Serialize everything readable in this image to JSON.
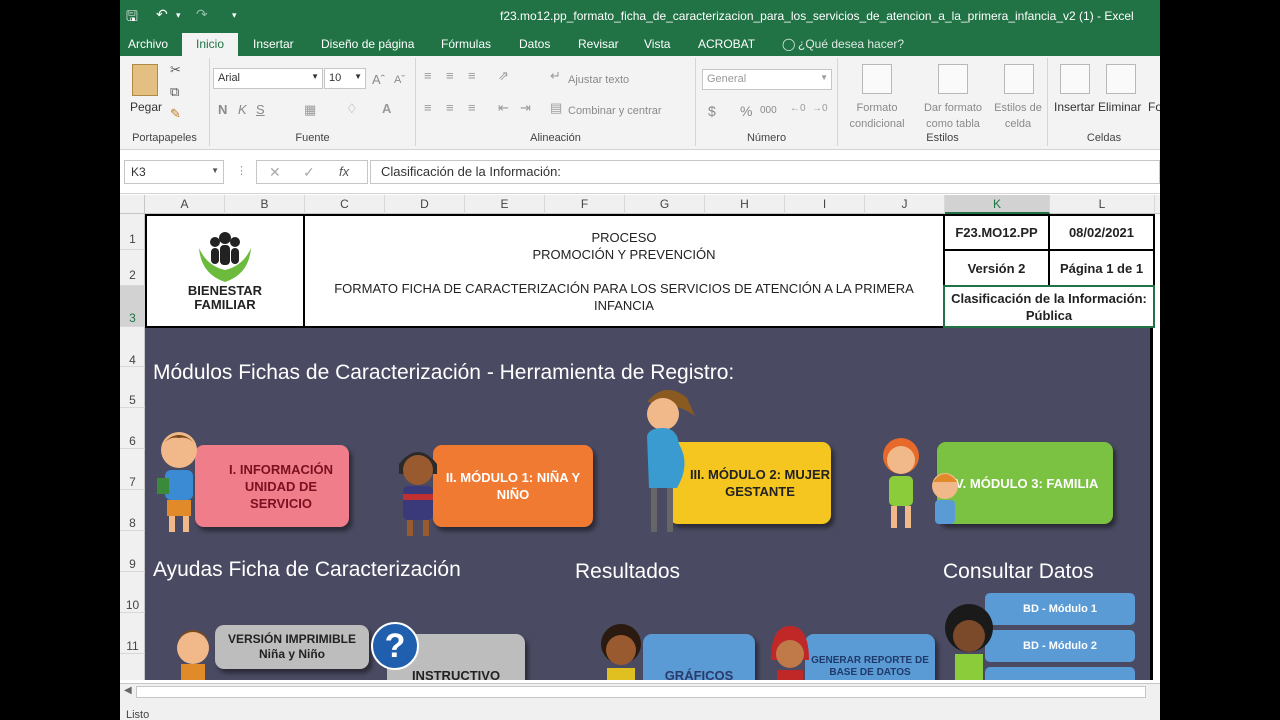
{
  "window": {
    "title": "f23.mo12.pp_formato_ficha_de_caracterizacion_para_los_servicios_de_atencion_a_la_primera_infancia_v2 (1) - Excel"
  },
  "tabs": [
    "Archivo",
    "Inicio",
    "Insertar",
    "Diseño de página",
    "Fórmulas",
    "Datos",
    "Revisar",
    "Vista",
    "ACROBAT",
    "¿Qué desea hacer?"
  ],
  "ribbon": {
    "portapapeles": {
      "label": "Portapapeles",
      "paste": "Pegar"
    },
    "fuente": {
      "label": "Fuente",
      "font": "Arial",
      "size": "10",
      "bold": "N",
      "italic": "K",
      "underline": "S"
    },
    "alineacion": {
      "label": "Alineación",
      "wrap": "Ajustar texto",
      "merge": "Combinar y centrar"
    },
    "numero": {
      "label": "Número",
      "format": "General",
      "currency": "$",
      "percent": "%",
      "thousands": "000"
    },
    "estilos": {
      "label": "Estilos",
      "cond": "Formato condicional",
      "table": "Dar formato como tabla",
      "cell": "Estilos de celda"
    },
    "celdas": {
      "label": "Celdas",
      "insert": "Insertar",
      "delete": "Eliminar",
      "format": "Fo"
    }
  },
  "formula_bar": {
    "name_box": "K3",
    "fx": "fx",
    "content": "Clasificación de la Información:"
  },
  "columns": [
    "A",
    "B",
    "C",
    "D",
    "E",
    "F",
    "G",
    "H",
    "I",
    "J",
    "K",
    "L"
  ],
  "rows": [
    "1",
    "2",
    "3",
    "4",
    "5",
    "6",
    "7",
    "8",
    "9",
    "10",
    "11"
  ],
  "header": {
    "logo_line1": "BIENESTAR",
    "logo_line2": "FAMILIAR",
    "proceso": "PROCESO",
    "promocion": "PROMOCIÓN Y PREVENCIÓN",
    "formato": "FORMATO FICHA DE CARACTERIZACIÓN PARA LOS SERVICIOS DE ATENCIÓN A LA PRIMERA INFANCIA",
    "code": "F23.MO12.PP",
    "date": "08/02/2021",
    "version": "Versión 2",
    "page": "Página 1 de 1",
    "class_label": "Clasificación de la Información:",
    "class_value": "Pública"
  },
  "dashboard": {
    "modules_title": "Módulos Fichas de Caracterización - Herramienta de Registro:",
    "ayudas_title": "Ayudas Ficha de Caracterización",
    "resultados_title": "Resultados",
    "consultar_title": "Consultar Datos",
    "btn1": "I. INFORMACIÓN UNIDAD DE SERVICIO",
    "btn2": "II. MÓDULO 1: NIÑA Y NIÑO",
    "btn3": "III. MÓDULO 2: MUJER GESTANTE",
    "btn4": "IV. MÓDULO 3: FAMILIA",
    "btn_imprimible": "VERSIÓN IMPRIMIBLE Niña y Niño",
    "btn_instructivo": "INSTRUCTIVO",
    "btn_graficos": "GRÁFICOS",
    "btn_reporte": "GENERAR REPORTE DE BASE DE DATOS",
    "bd1": "BD - Módulo 1",
    "bd2": "BD - Módulo 2",
    "help_icon": "?",
    "colors": {
      "bg": "#4a4a62",
      "btn1": "#f07d8a",
      "btn2": "#f07a32",
      "btn3": "#f5c520",
      "btn4": "#7cc242",
      "blue": "#5b9bd5",
      "gray": "#bdbdbd"
    }
  },
  "status": {
    "text": "Listo"
  }
}
